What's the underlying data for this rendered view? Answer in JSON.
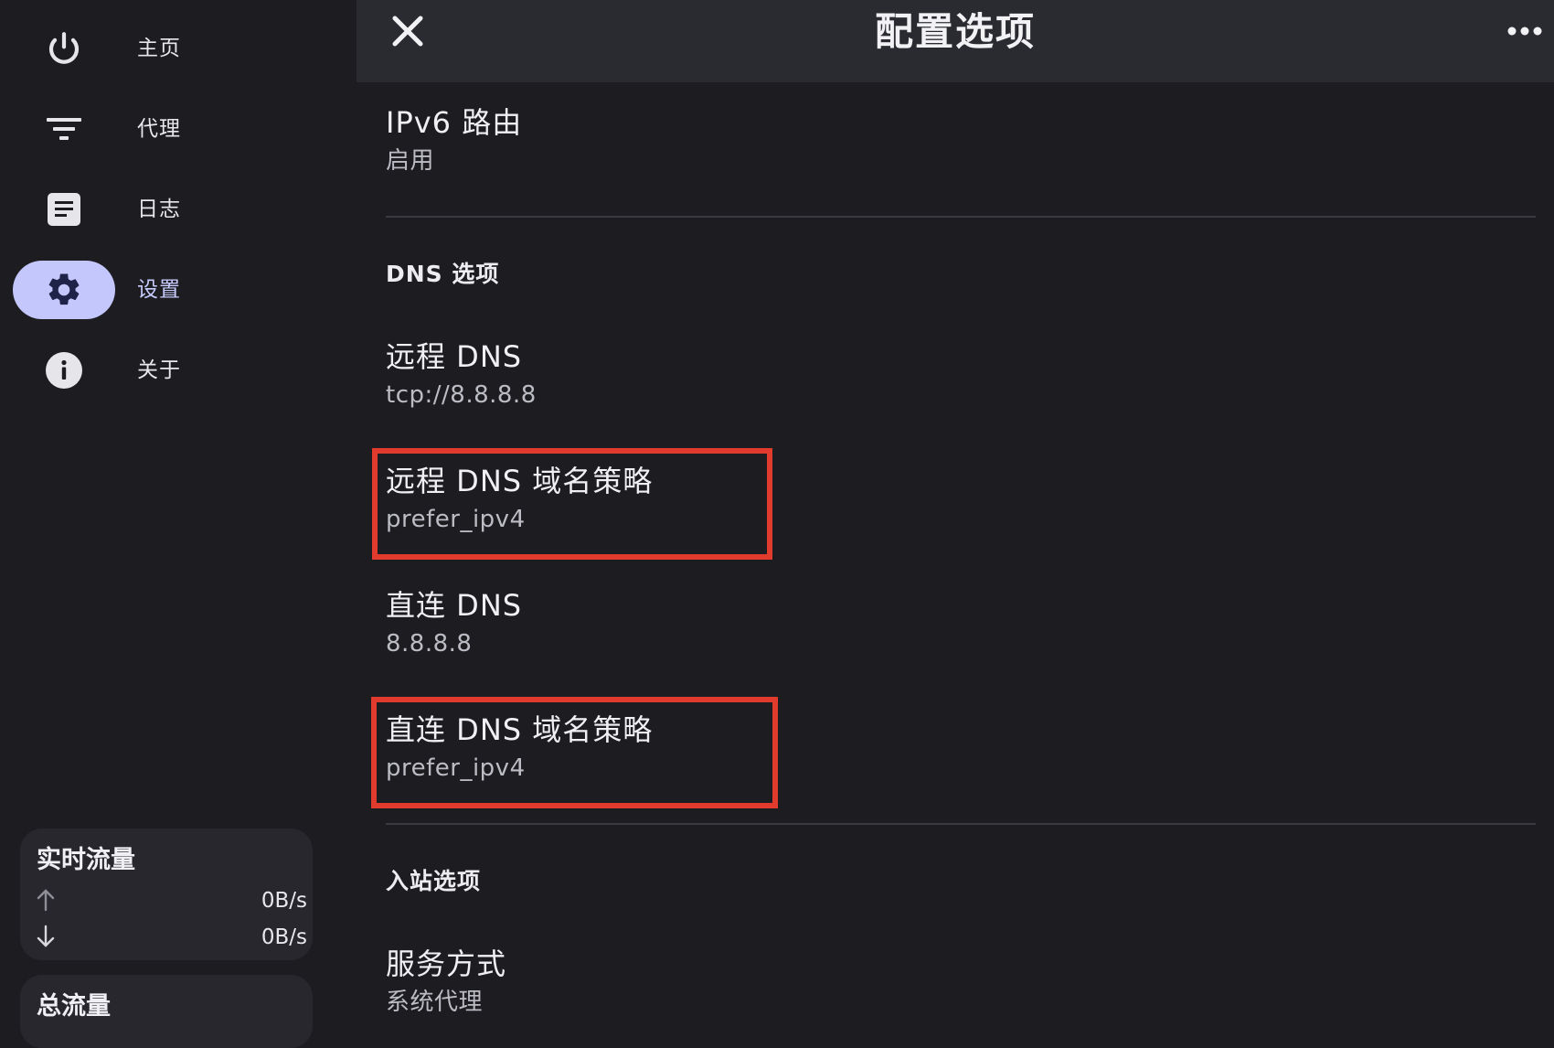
{
  "sidebar": {
    "items": [
      {
        "label": "主页",
        "icon": "power-icon"
      },
      {
        "label": "代理",
        "icon": "filter-icon"
      },
      {
        "label": "日志",
        "icon": "log-document-icon"
      },
      {
        "label": "设置",
        "icon": "gear-icon",
        "active": true
      },
      {
        "label": "关于",
        "icon": "info-icon"
      }
    ],
    "realtime": {
      "title": "实时流量",
      "upload": "0B/s",
      "download": "0B/s"
    },
    "total": {
      "title": "总流量"
    }
  },
  "topbar": {
    "title": "配置选项"
  },
  "content": {
    "ipv6": {
      "title": "IPv6 路由",
      "value": "启用"
    },
    "dns_section": "DNS 选项",
    "remote_dns": {
      "title": "远程 DNS",
      "value": "tcp://8.8.8.8"
    },
    "remote_dns_strategy": {
      "title": "远程 DNS 域名策略",
      "value": "prefer_ipv4"
    },
    "direct_dns": {
      "title": "直连 DNS",
      "value": "8.8.8.8"
    },
    "direct_dns_strategy": {
      "title": "直连 DNS 域名策略",
      "value": "prefer_ipv4"
    },
    "inbound_section": "入站选项",
    "service_mode": {
      "title": "服务方式",
      "value": "系统代理"
    }
  },
  "colors": {
    "accent": "#c3c7fb",
    "highlight": "#e03b2d",
    "background": "#1c1c21",
    "topbar": "#2a2b31"
  }
}
